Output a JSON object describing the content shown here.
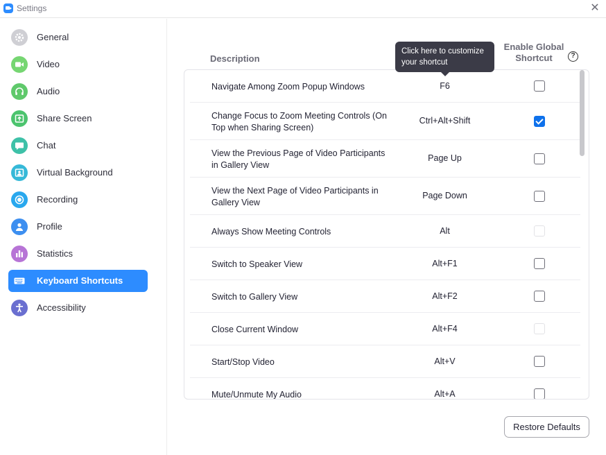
{
  "window": {
    "title": "Settings"
  },
  "sidebar": {
    "items": [
      {
        "label": "General",
        "icon": "gear-icon",
        "color": "#d9d9dd",
        "active": false
      },
      {
        "label": "Video",
        "icon": "video-camera-icon",
        "color": "#76d672",
        "active": false
      },
      {
        "label": "Audio",
        "icon": "headphones-icon",
        "color": "#5fc96b",
        "active": false
      },
      {
        "label": "Share Screen",
        "icon": "share-screen-icon",
        "color": "#4cc46e",
        "active": false
      },
      {
        "label": "Chat",
        "icon": "chat-bubble-icon",
        "color": "#3ec1a8",
        "active": false
      },
      {
        "label": "Virtual Background",
        "icon": "person-frame-icon",
        "color": "#36b9d8",
        "active": false
      },
      {
        "label": "Recording",
        "icon": "record-icon",
        "color": "#29a8ee",
        "active": false
      },
      {
        "label": "Profile",
        "icon": "person-icon",
        "color": "#3d8ff0",
        "active": false
      },
      {
        "label": "Statistics",
        "icon": "bar-chart-icon",
        "color": "#b774d6",
        "active": false
      },
      {
        "label": "Keyboard Shortcuts",
        "icon": "keyboard-icon",
        "color": "#2d8cff",
        "active": true
      },
      {
        "label": "Accessibility",
        "icon": "accessibility-icon",
        "color": "#6a6fd0",
        "active": false
      }
    ]
  },
  "main": {
    "header_description": "Description",
    "header_enable_global": "Enable Global Shortcut",
    "help_icon": "?",
    "tooltip": "Click here to customize your shortcut",
    "restore_defaults": "Restore Defaults",
    "rows": [
      {
        "description": "Navigate Among Zoom Popup Windows",
        "shortcut": "F6",
        "global": "unchecked"
      },
      {
        "description": "Change Focus to Zoom Meeting Controls (On Top when Sharing Screen)",
        "shortcut": "Ctrl+Alt+Shift",
        "global": "checked"
      },
      {
        "description": "View the Previous Page of Video Participants in Gallery View",
        "shortcut": "Page Up",
        "global": "unchecked"
      },
      {
        "description": "View the Next Page of Video Participants in Gallery View",
        "shortcut": "Page Down",
        "global": "unchecked"
      },
      {
        "description": "Always Show Meeting Controls",
        "shortcut": "Alt",
        "global": "disabled"
      },
      {
        "description": "Switch to Speaker View",
        "shortcut": "Alt+F1",
        "global": "unchecked"
      },
      {
        "description": "Switch to Gallery View",
        "shortcut": "Alt+F2",
        "global": "unchecked"
      },
      {
        "description": "Close Current Window",
        "shortcut": "Alt+F4",
        "global": "disabled"
      },
      {
        "description": "Start/Stop Video",
        "shortcut": "Alt+V",
        "global": "unchecked"
      },
      {
        "description": "Mute/Unmute My Audio",
        "shortcut": "Alt+A",
        "global": "unchecked"
      }
    ]
  },
  "colors": {
    "accent": "#2d8cff",
    "checkbox_checked": "#0e71eb",
    "tooltip_bg": "#3b3b47"
  }
}
